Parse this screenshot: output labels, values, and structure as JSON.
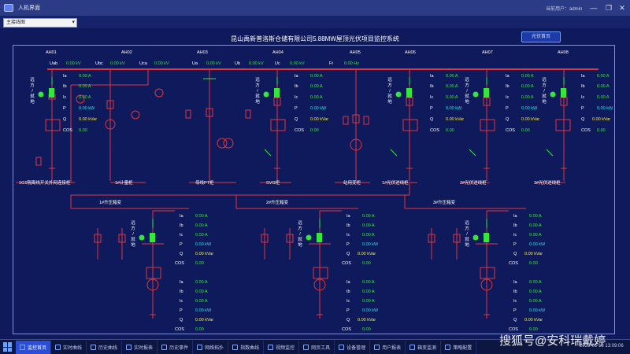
{
  "window": {
    "title": "人机界面",
    "user": "当前用户：admin",
    "minimize": "—",
    "restore": "❐",
    "close": "✕"
  },
  "menu": {
    "combo": "主接线图"
  },
  "main": {
    "title": "昆山禹新普洛斯仓储有限公司5.88MW屋顶光伏项目监控系统",
    "pv_button": "光伏首页"
  },
  "top": {
    "cabinets": [
      "AH01",
      "AH02",
      "AH03",
      "AH04",
      "AH05",
      "AH06",
      "AH07",
      "AH08"
    ],
    "bus": {
      "uab_l": "Uab",
      "uab_v": "0.00 kV",
      "ubc_l": "Ubc",
      "ubc_v": "0.00 kV",
      "uca_l": "Uca",
      "uca_v": "0.00 kV",
      "ua_l": "Ua",
      "ua_v": "0.00 kV",
      "ub_l": "Ub",
      "ub_v": "0.00 kV",
      "uc_l": "Uc",
      "uc_v": "0.00 kV",
      "fr_l": "Fr",
      "fr_v": "0.00 Hz"
    },
    "bottom_labels": [
      "1G1隔离线开关外网连接柜",
      "1#计量柜",
      "母线PT柜",
      "SVG柜",
      "站用变柜",
      "1#光伏进线柜",
      "2#光伏进线柜",
      "3#光伏进线柜"
    ]
  },
  "local_remote": [
    "远",
    "方",
    "/",
    "就",
    "地"
  ],
  "meas_labels": [
    "Ia",
    "Ib",
    "Ic",
    "P",
    "Q",
    "COS"
  ],
  "feeder": {
    "ia": "0.00 A",
    "ib": "0.00 A",
    "ic": "0.00 A",
    "p": "0.00 kW",
    "q": "0.00 kVar",
    "cos": "0.00"
  },
  "boxes": [
    {
      "title": "1#升压箱变"
    },
    {
      "title": "2#升压箱变"
    },
    {
      "title": "3#升压箱变"
    }
  ],
  "box_meas": {
    "ia": "0.00 A",
    "ib": "0.00 A",
    "ic": "0.00 A",
    "p": "0.00 kW",
    "q": "0.00 kVar",
    "cos": "0.00"
  },
  "taskbar": {
    "items": [
      "监控首页",
      "实时曲线",
      "历史曲线",
      "实时报表",
      "历史事件",
      "网络拓扑",
      "指数曲线",
      "视频监控",
      "网页工具",
      "设备管理",
      "用户报表",
      "箱变监测",
      "策略配置"
    ],
    "clock": "2025-06-18 13:09:06"
  },
  "watermark": "搜狐号@安科瑞戴婷",
  "colors": {
    "background": "#0f1a5c",
    "bus": "#e3343c",
    "green": "#33e83a",
    "cyan": "#27e0f0",
    "yellow": "#f2e84a",
    "accent": "#2a4ed8"
  }
}
